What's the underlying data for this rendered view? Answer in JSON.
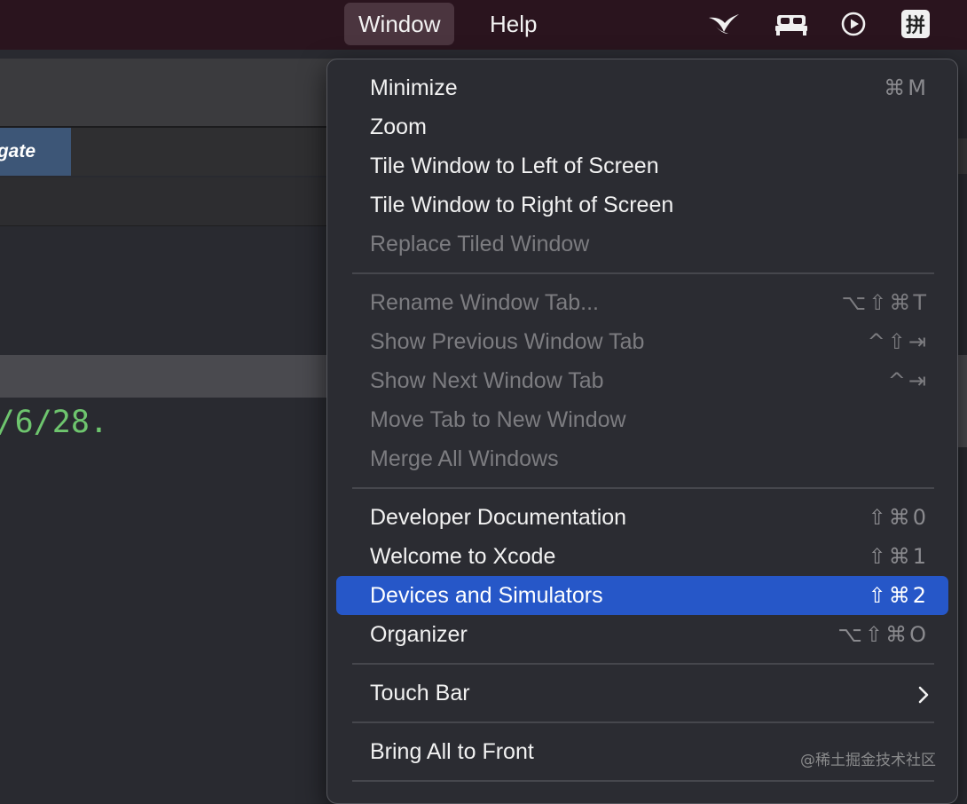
{
  "menubar": {
    "window_label": "Window",
    "help_label": "Help",
    "ime_label": "拼"
  },
  "background": {
    "tab_label": "gate",
    "code_text": "/6/28."
  },
  "menu": {
    "items": [
      {
        "label": "Minimize",
        "shortcut": "⌘M",
        "enabled": true
      },
      {
        "label": "Zoom",
        "shortcut": "",
        "enabled": true
      },
      {
        "label": "Tile Window to Left of Screen",
        "shortcut": "",
        "enabled": true
      },
      {
        "label": "Tile Window to Right of Screen",
        "shortcut": "",
        "enabled": true
      },
      {
        "label": "Replace Tiled Window",
        "shortcut": "",
        "enabled": false
      },
      {
        "label": "Rename Window Tab...",
        "shortcut": "⌥⇧⌘T",
        "enabled": false
      },
      {
        "label": "Show Previous Window Tab",
        "shortcut": "^⇧⇥",
        "enabled": false
      },
      {
        "label": "Show Next Window Tab",
        "shortcut": "^⇥",
        "enabled": false
      },
      {
        "label": "Move Tab to New Window",
        "shortcut": "",
        "enabled": false
      },
      {
        "label": "Merge All Windows",
        "shortcut": "",
        "enabled": false
      },
      {
        "label": "Developer Documentation",
        "shortcut": "⇧⌘0",
        "enabled": true
      },
      {
        "label": "Welcome to Xcode",
        "shortcut": "⇧⌘1",
        "enabled": true
      },
      {
        "label": "Devices and Simulators",
        "shortcut": "⇧⌘2",
        "enabled": true,
        "selected": true
      },
      {
        "label": "Organizer",
        "shortcut": "⌥⇧⌘O",
        "enabled": true
      },
      {
        "label": "Touch Bar",
        "shortcut": "",
        "enabled": true,
        "submenu": true
      },
      {
        "label": "Bring All to Front",
        "shortcut": "",
        "enabled": true
      }
    ]
  },
  "watermark": "@稀土掘金技术社区",
  "colors": {
    "menubar_bg": "#2a141e",
    "menu_bg": "#2b2c32",
    "selection": "#2657c8",
    "code_green": "#6ec56e",
    "tab_blue": "#3d5677"
  }
}
